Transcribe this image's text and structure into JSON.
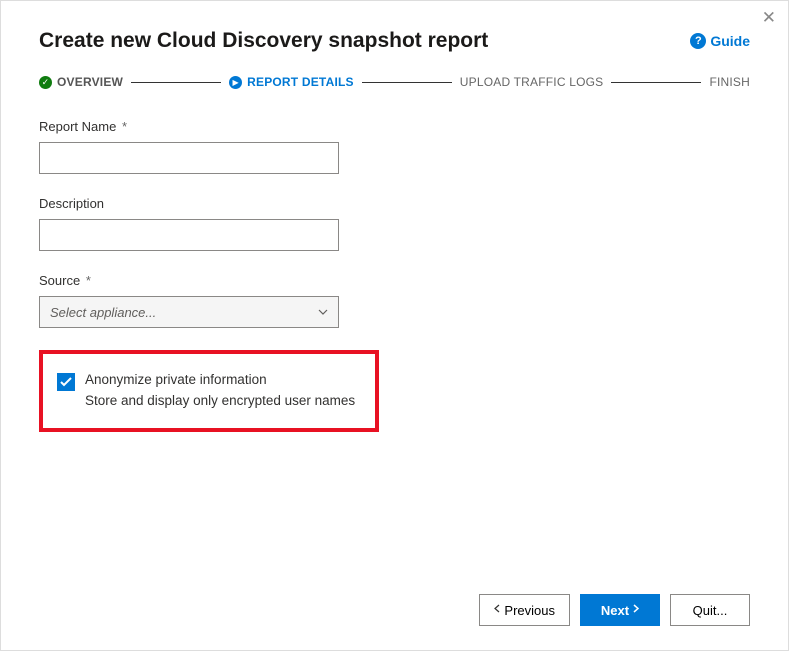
{
  "header": {
    "title": "Create new Cloud Discovery snapshot report",
    "guide_label": "Guide"
  },
  "stepper": {
    "steps": [
      {
        "label": "OVERVIEW",
        "state": "done"
      },
      {
        "label": "REPORT DETAILS",
        "state": "active"
      },
      {
        "label": "UPLOAD TRAFFIC LOGS",
        "state": "future"
      },
      {
        "label": "FINISH",
        "state": "future"
      }
    ]
  },
  "form": {
    "report_name": {
      "label": "Report Name",
      "required": "*",
      "value": ""
    },
    "description": {
      "label": "Description",
      "value": ""
    },
    "source": {
      "label": "Source",
      "required": "*",
      "placeholder": "Select appliance..."
    },
    "anonymize": {
      "checked": true,
      "label": "Anonymize private information",
      "sub": "Store and display only encrypted user names"
    }
  },
  "footer": {
    "previous": "Previous",
    "next": "Next",
    "quit": "Quit..."
  },
  "icons": {
    "close": "✕",
    "help": "?",
    "check": "✓",
    "play": "▶",
    "chevron_down": "⌄",
    "chevron_left": "‹",
    "chevron_right": "›"
  }
}
